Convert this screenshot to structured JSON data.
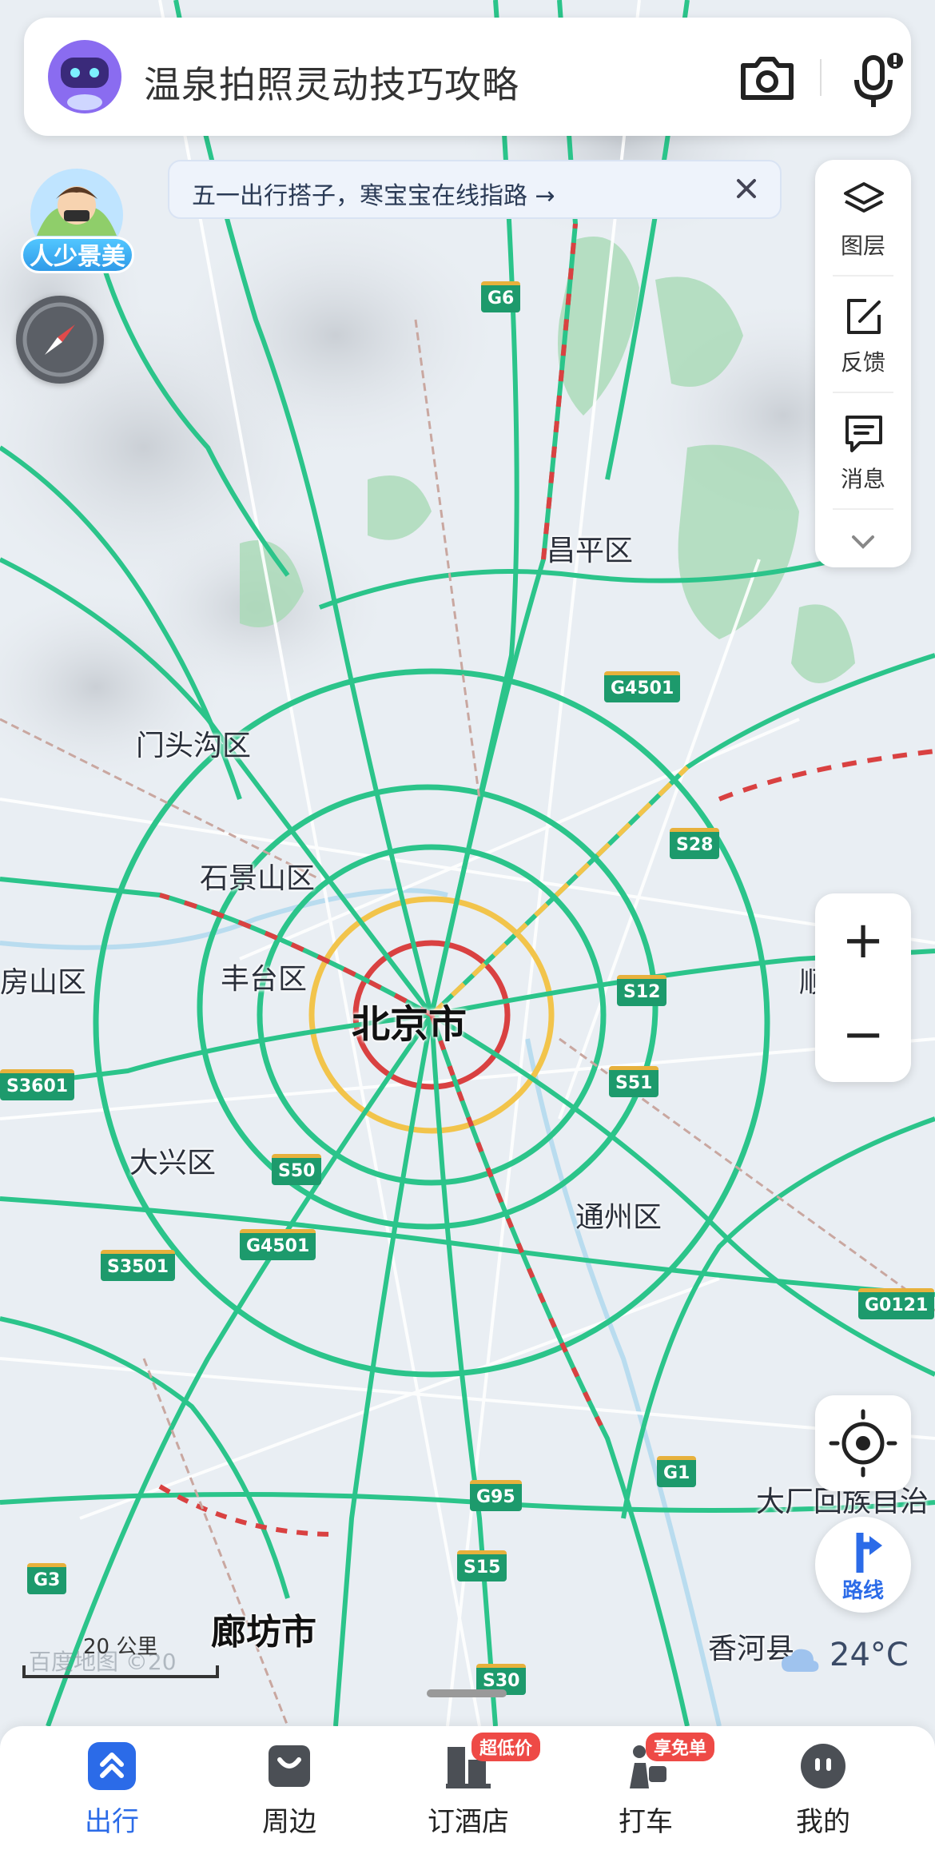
{
  "search": {
    "query": "温泉拍照灵动技巧攻略"
  },
  "promo": {
    "mascot_label": "人少景美",
    "tip_text": "五一出行搭子，寒宝宝在线指路 →"
  },
  "right_panel": {
    "layers": "图层",
    "feedback": "反馈",
    "messages": "消息"
  },
  "zoom": {
    "in": "+",
    "out": "−"
  },
  "route_label": "路线",
  "weather": {
    "temp": "24°C"
  },
  "map": {
    "places": [
      "昌平区",
      "门头沟区",
      "石景山区",
      "房山区",
      "丰台区",
      "北京市",
      "大兴区",
      "通州区",
      "廊坊市",
      "香河县",
      "大厂回族自治",
      "顺"
    ],
    "roads": [
      "G6",
      "G4501",
      "S28",
      "S12",
      "S51",
      "S3601",
      "S50",
      "G4501",
      "S3501",
      "G0121",
      "G1",
      "G95",
      "S15",
      "G3",
      "S30"
    ],
    "scale_label": "20 公里",
    "watermark": "百度地图 ©20"
  },
  "tabs": [
    {
      "label": "出行",
      "active": true
    },
    {
      "label": "周边",
      "active": false
    },
    {
      "label": "订酒店",
      "badge": "超低价",
      "active": false
    },
    {
      "label": "打车",
      "badge": "享免单",
      "active": false
    },
    {
      "label": "我的",
      "active": false
    }
  ],
  "colors": {
    "accent": "#2b6be8",
    "road_green": "#2bc48a",
    "road_yellow": "#f2c44b",
    "road_red": "#d94141",
    "park_green": "#a8d9b5",
    "badge_red": "#ee4a46"
  }
}
